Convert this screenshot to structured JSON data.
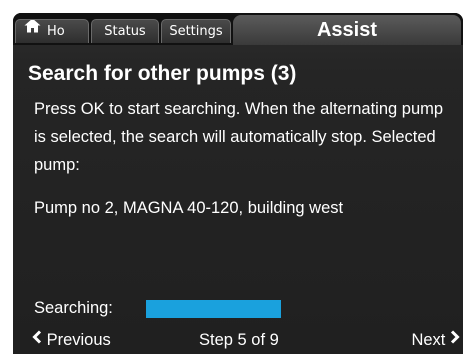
{
  "tabs": {
    "home_label": "Ho",
    "status_label": "Status",
    "settings_label": "Settings",
    "assist_label": "Assist",
    "home_icon": "home-icon"
  },
  "main": {
    "title": "Search for other pumps (3)",
    "instruction": "Press OK to start searching. When the alternating pump is selected, the search will automatically stop. Selected pump:",
    "selected_pump": "Pump no 2, MAGNA 40-120, building west",
    "searching_label": "Searching:",
    "search_progress_fraction": 0.55
  },
  "footer": {
    "previous_label": "Previous",
    "step_text": "Step 5 of 9",
    "next_label": "Next",
    "previous_icon": "chevron-left-icon",
    "next_icon": "chevron-right-icon"
  },
  "colors": {
    "background": "#222222",
    "progress": "#1aa1dd",
    "text": "#ffffff"
  }
}
